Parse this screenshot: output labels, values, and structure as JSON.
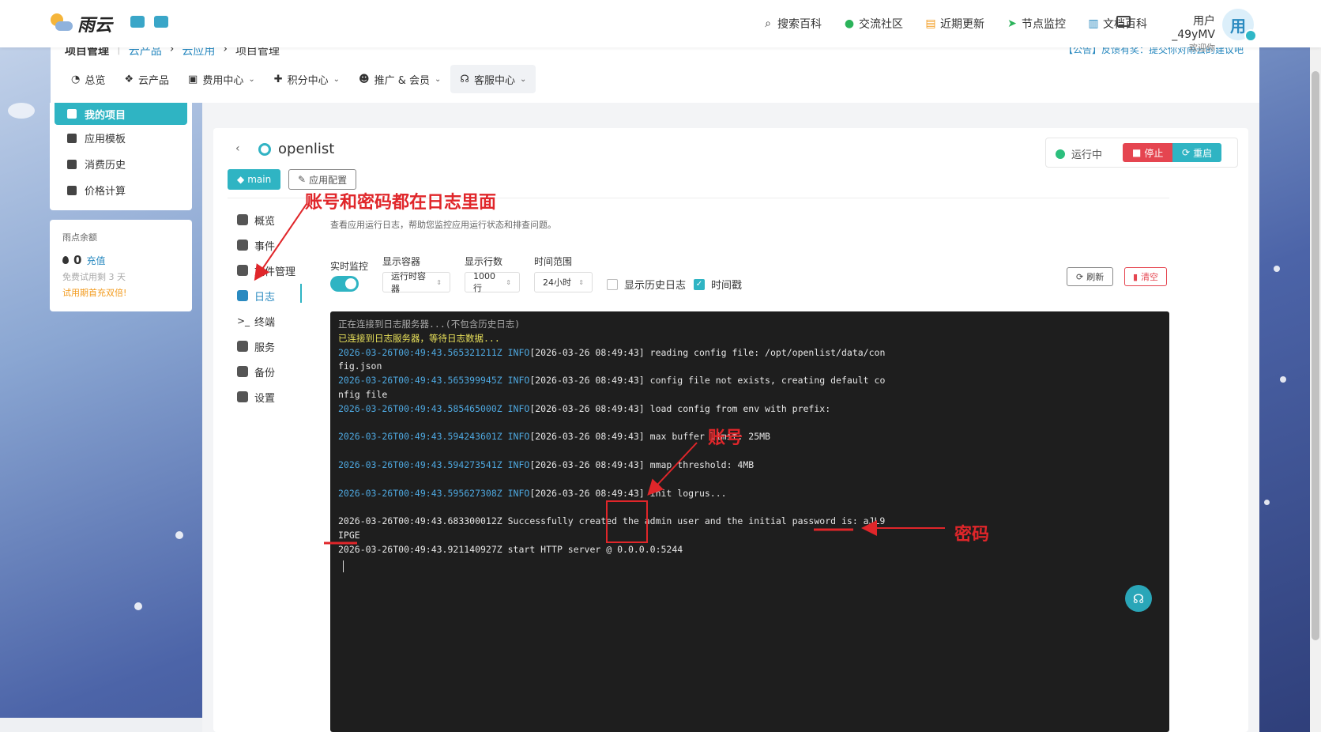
{
  "topbar": {
    "brand": "雨云",
    "nav": [
      {
        "icon": "search-icon",
        "label": "搜索百科"
      },
      {
        "icon": "wechat-icon",
        "label": "交流社区"
      },
      {
        "icon": "update-icon",
        "label": "近期更新"
      },
      {
        "icon": "location-icon",
        "label": "节点监控"
      },
      {
        "icon": "book-icon",
        "label": "文档百科"
      }
    ],
    "user_name": "用户_49yMV",
    "welcome": "欢迎你",
    "avatar_text": "用"
  },
  "subnav": {
    "breadcrumb": [
      "项目管理",
      "云产品",
      "云应用",
      "项目管理"
    ],
    "notice": "【公告】反馈有奖：提交你对雨云的建议吧",
    "menu": [
      {
        "label": "总览",
        "dropdown": false
      },
      {
        "label": "云产品",
        "dropdown": false
      },
      {
        "label": "费用中心",
        "dropdown": true
      },
      {
        "label": "积分中心",
        "dropdown": true
      },
      {
        "label": "推广 & 会员",
        "dropdown": true
      },
      {
        "label": "客服中心",
        "dropdown": true
      }
    ]
  },
  "sidebar": {
    "items": [
      "我的项目",
      "应用模板",
      "消费历史",
      "价格计算"
    ],
    "balance_title": "雨点余额",
    "balance_amount": "0",
    "recharge": "充值",
    "trial": "免费试用剩 3 天",
    "promo": "试用期首充双倍!"
  },
  "app": {
    "name": "openlist",
    "status": "运行中",
    "stop": "停止",
    "restart": "重启",
    "branch": "main",
    "config": "应用配置",
    "nav": [
      "概览",
      "事件",
      "文件管理",
      "日志",
      "终端",
      "服务",
      "备份",
      "设置"
    ],
    "active_nav": "日志"
  },
  "logs": {
    "description": "查看应用运行日志，帮助您监控应用运行状态和排查问题。",
    "realtime_label": "实时监控",
    "container_label": "显示容器",
    "container_value": "运行时容器",
    "rows_label": "显示行数",
    "rows_value": "1000行",
    "range_label": "时间范围",
    "range_value": "24小时",
    "history_label": "显示历史日志",
    "timestamp_label": "时间戳",
    "history_checked": false,
    "timestamp_checked": true,
    "refresh": "刷新",
    "clear": "清空",
    "lines": [
      {
        "ts": "",
        "text": "正在连接到日志服务器...(不包含历史日志)",
        "style": "gray"
      },
      {
        "ts": "",
        "text": "已连接到日志服务器，等待日志数据...",
        "style": "yellow"
      },
      {
        "ts": "2026-03-26T00:49:43.565321211Z INFO",
        "text": "[2026-03-26 08:49:43] reading config file: /opt/openlist/data/con"
      },
      {
        "ts": "",
        "text": "fig.json"
      },
      {
        "ts": "2026-03-26T00:49:43.565399945Z INFO",
        "text": "[2026-03-26 08:49:43] config file not exists, creating default co"
      },
      {
        "ts": "",
        "text": "nfig file"
      },
      {
        "ts": "2026-03-26T00:49:43.585465000Z INFO",
        "text": "[2026-03-26 08:49:43] load config from env with prefix:"
      },
      {
        "ts": "",
        "text": ""
      },
      {
        "ts": "2026-03-26T00:49:43.594243601Z INFO",
        "text": "[2026-03-26 08:49:43] max buffer limit: 25MB"
      },
      {
        "ts": "",
        "text": ""
      },
      {
        "ts": "2026-03-26T00:49:43.594273541Z INFO",
        "text": "[2026-03-26 08:49:43] mmap threshold: 4MB"
      },
      {
        "ts": "",
        "text": ""
      },
      {
        "ts": "2026-03-26T00:49:43.595627308Z INFO",
        "text": "[2026-03-26 08:49:43] init logrus..."
      },
      {
        "ts": "",
        "text": ""
      },
      {
        "ts": "",
        "text": "2026-03-26T00:49:43.683300012Z Successfully created the admin user and the initial password is: aJL9"
      },
      {
        "ts": "",
        "text": "IPGE"
      },
      {
        "ts": "",
        "text": "2026-03-26T00:49:43.921140927Z start HTTP server @ 0.0.0.0:5244"
      }
    ]
  },
  "annotations": {
    "logs_hint": "账号和密码都在日志里面",
    "account": "账号",
    "password": "密码",
    "color": "#e0262a"
  },
  "colors": {
    "accent": "#2fb4c3",
    "danger": "#e54550",
    "link": "#2a8ac0"
  }
}
